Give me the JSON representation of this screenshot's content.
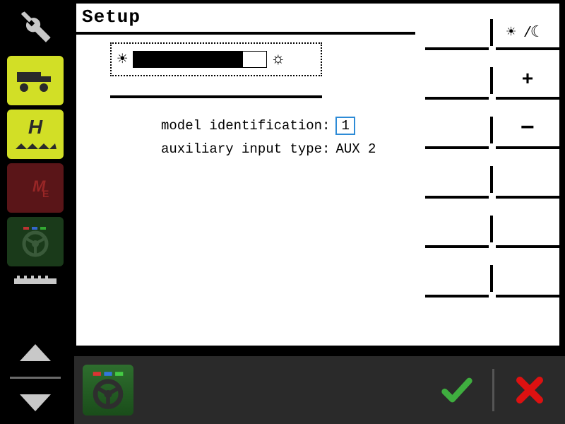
{
  "page": {
    "title": "Setup",
    "model_id_label": "model identification:",
    "model_id_value": "1",
    "aux_label": "auxiliary input type:",
    "aux_value": "AUX 2",
    "brightness_percent": 82
  },
  "softkeys": {
    "daynight": "☀/☾",
    "plus": "+",
    "minus": "−"
  },
  "sidebar": {
    "tools": "tools",
    "truck": "truck",
    "h_label": "H",
    "me_label": "ME"
  }
}
